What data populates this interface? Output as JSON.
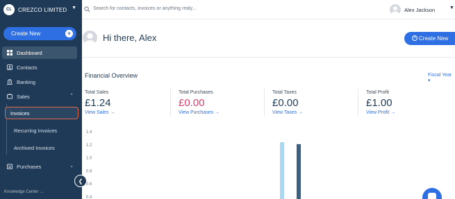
{
  "brand": {
    "logo_text": "CL",
    "name": "CREZCO LIMITED"
  },
  "sidebar": {
    "create_label": "Create New",
    "items": [
      {
        "label": "Dashboard",
        "icon": "dashboard-icon"
      },
      {
        "label": "Contacts",
        "icon": "contacts-icon"
      },
      {
        "label": "Banking",
        "icon": "bank-icon"
      },
      {
        "label": "Sales",
        "icon": "sales-icon"
      }
    ],
    "sales_subitems": [
      {
        "label": "Invoices"
      },
      {
        "label": "Recurring Invoices"
      },
      {
        "label": "Archived Invoices"
      }
    ],
    "purchases_label": "Purchases",
    "knowledge_label": "Knowledge Center →"
  },
  "topbar": {
    "search_placeholder": "Search for contacts, invoices or anything realy...",
    "user_name": "Alex Jackson"
  },
  "main": {
    "greeting": "Hi there, Alex",
    "create_label": "Create New",
    "section_title": "Financial Overview",
    "fiscal_label": "Fiscal Year ▾",
    "kpis": [
      {
        "label": "Total Sales",
        "value": "£1.24",
        "link": "View Sales →",
        "color": "#1f3a56"
      },
      {
        "label": "Total Purchases",
        "value": "£0.00",
        "link": "View Purchases →",
        "color": "#d6406c"
      },
      {
        "label": "Total Taxes",
        "value": "£0.00",
        "link": "View Taxes →",
        "color": "#1f3a56"
      },
      {
        "label": "Total Profit",
        "value": "£1.00",
        "link": "View Profit →",
        "color": "#1f3a56"
      }
    ]
  },
  "chart_data": {
    "type": "bar",
    "y_ticks": [
      "1.4",
      "1.2",
      "1.0",
      "0.8",
      "0.6",
      "0.4"
    ],
    "ylim": [
      0.4,
      1.4
    ],
    "series": [
      {
        "values": [
          1.24
        ],
        "color": "#a9d9f2"
      },
      {
        "values": [
          1.21
        ],
        "color": "#3f5f80"
      }
    ]
  }
}
